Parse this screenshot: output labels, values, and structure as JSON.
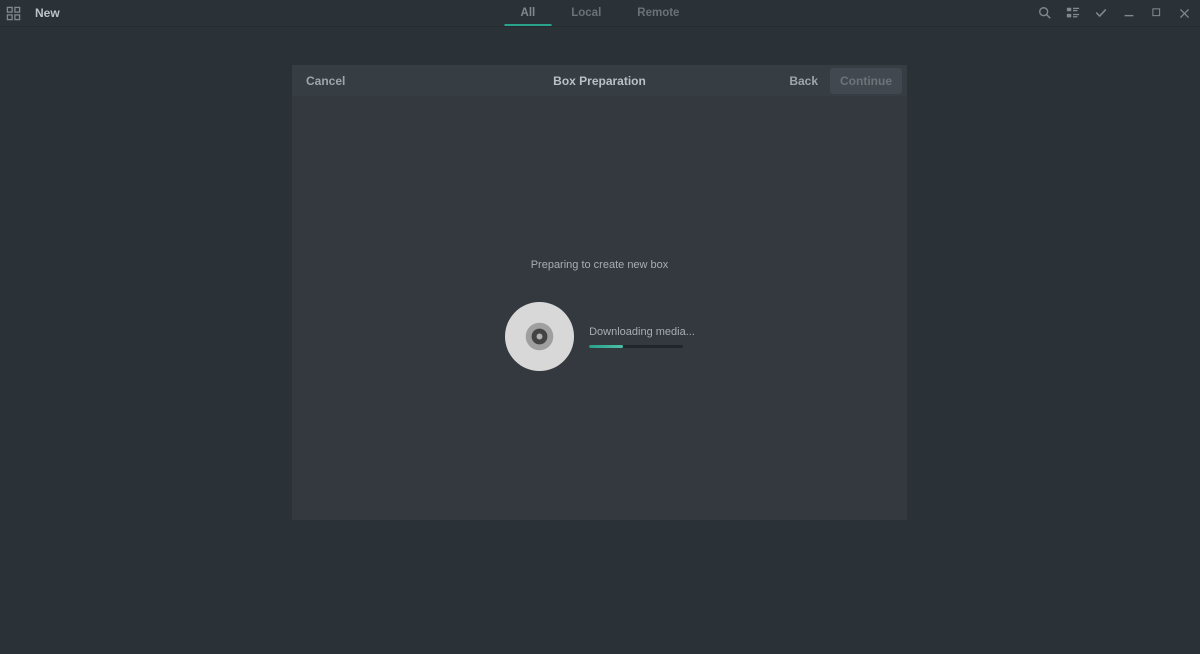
{
  "topbar": {
    "new_label": "New",
    "tabs": {
      "all": "All",
      "local": "Local",
      "remote": "Remote"
    }
  },
  "dialog": {
    "cancel": "Cancel",
    "title": "Box Preparation",
    "back": "Back",
    "continue": "Continue",
    "preparing": "Preparing to create new box",
    "downloading": "Downloading media..."
  }
}
